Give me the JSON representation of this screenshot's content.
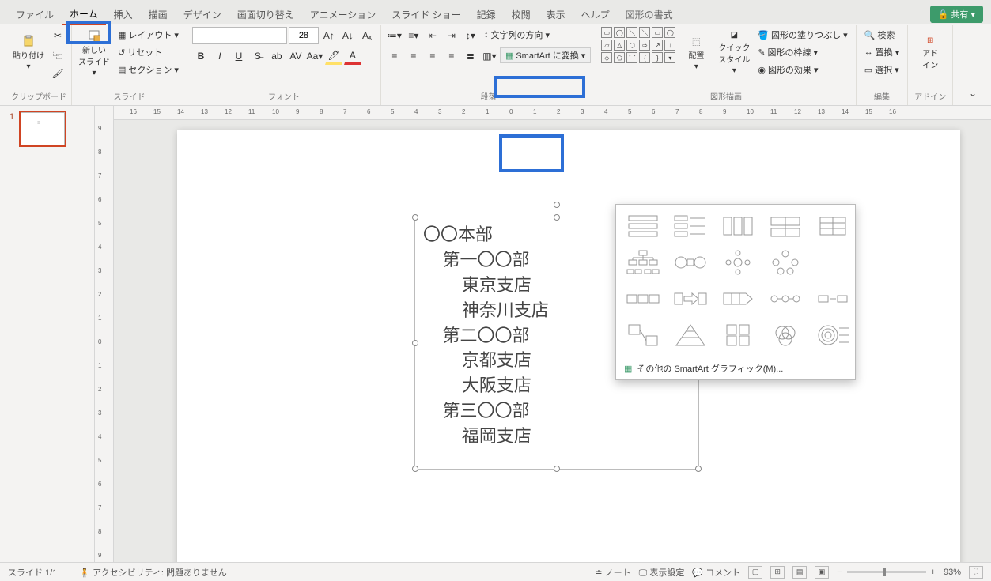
{
  "tabs": {
    "file": "ファイル",
    "home": "ホーム",
    "insert": "挿入",
    "draw": "描画",
    "design": "デザイン",
    "transitions": "画面切り替え",
    "animations": "アニメーション",
    "slideshow": "スライド ショー",
    "record": "記録",
    "review": "校閲",
    "view": "表示",
    "help": "ヘルプ",
    "shapeformat": "図形の書式"
  },
  "share": "共有",
  "ribbon": {
    "clipboard": {
      "paste": "貼り付け",
      "label": "クリップボード"
    },
    "slides": {
      "new": "新しい\nスライド",
      "layout": "レイアウト",
      "reset": "リセット",
      "section": "セクション",
      "label": "スライド"
    },
    "font": {
      "size": "28",
      "label": "フォント"
    },
    "paragraph": {
      "textdir": "文字列の方向",
      "label": "段落",
      "smartart": "SmartArt に変換"
    },
    "drawing": {
      "arrange": "配置",
      "quick": "クイック\nスタイル",
      "fill": "図形の塗りつぶし",
      "outline": "図形の枠線",
      "effects": "図形の効果",
      "label": "図形描画"
    },
    "editing": {
      "find": "検索",
      "replace": "置換",
      "select": "選択",
      "label": "編集"
    },
    "addin": {
      "btn": "アド\nイン",
      "label": "アドイン"
    }
  },
  "smartart_more": "その他の SmartArt グラフィック(M)...",
  "slide_text": {
    "l1": "〇〇本部",
    "l2": "    第一〇〇部",
    "l3": "        東京支店",
    "l4": "        神奈川支店",
    "l5": "    第二〇〇部",
    "l6": "        京都支店",
    "l7": "        大阪支店",
    "l8": "    第三〇〇部",
    "l9": "        福岡支店"
  },
  "thumb_num": "1",
  "ruler_h": [
    "16",
    "15",
    "14",
    "13",
    "12",
    "11",
    "10",
    "9",
    "8",
    "7",
    "6",
    "5",
    "4",
    "3",
    "2",
    "1",
    "0",
    "1",
    "2",
    "3",
    "4",
    "5",
    "6",
    "7",
    "8",
    "9",
    "10",
    "11",
    "12",
    "13",
    "14",
    "15",
    "16"
  ],
  "ruler_v": [
    "9",
    "8",
    "7",
    "6",
    "5",
    "4",
    "3",
    "2",
    "1",
    "0",
    "1",
    "2",
    "3",
    "4",
    "5",
    "6",
    "7",
    "8",
    "9"
  ],
  "status": {
    "slide": "スライド 1/1",
    "lang": "",
    "access": "アクセシビリティ: 問題ありません",
    "notes": "ノート",
    "display": "表示設定",
    "comment": "コメント",
    "zoom": "93%"
  }
}
